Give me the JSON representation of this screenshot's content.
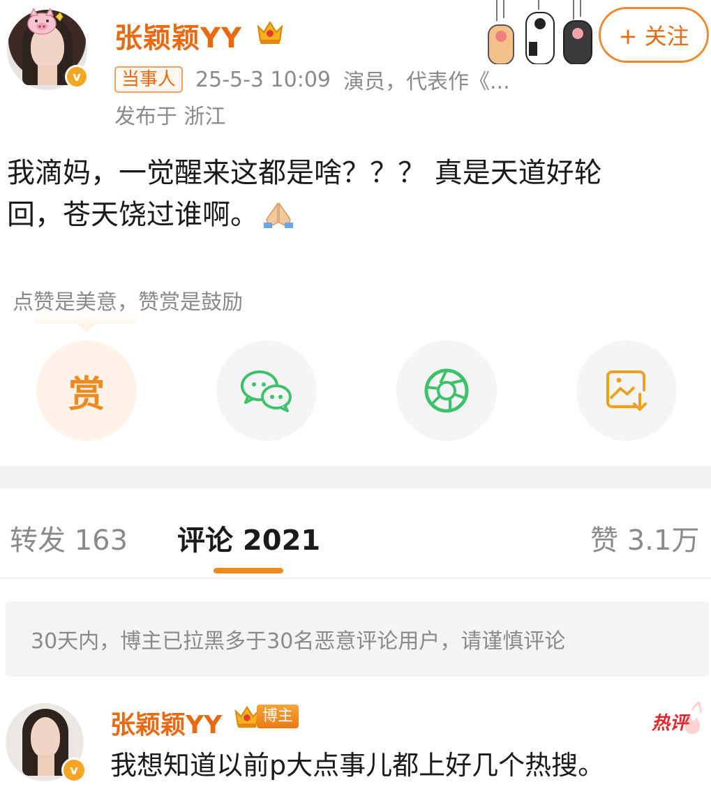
{
  "post": {
    "username": "张颖颖YY",
    "tag": "当事人",
    "time": "25-5-3 10:09",
    "bio": "演员，代表作《...",
    "location": "发布于 浙江",
    "content_line1": "我滴妈，一觉醒来这都是啥？？？ 真是天道好轮",
    "content_line2": "回，苍天饶过谁啊。",
    "follow_label": "+ 关注",
    "verified_badge": "v"
  },
  "reward": {
    "tip": "点赞是美意，赞赏是鼓励",
    "reward_char": "赏"
  },
  "actions": [
    {
      "name": "reward",
      "icon": "reward-icon"
    },
    {
      "name": "wechat",
      "icon": "wechat-icon"
    },
    {
      "name": "moments",
      "icon": "moments-icon"
    },
    {
      "name": "save-image",
      "icon": "save-image-icon"
    }
  ],
  "tabs": {
    "repost": "转发 163",
    "comments": "评论 2021",
    "likes": "赞 3.1万"
  },
  "notice": "30天内，博主已拉黑多于30名恶意评论用户，请谨慎评论",
  "comment": {
    "username": "张颖颖YY",
    "badge": "博主",
    "hot_label": "热评",
    "text": "我想知道以前p大点事儿都上好几个热搜。",
    "verified_badge": "v"
  },
  "colors": {
    "accent": "#e96a10",
    "wechat": "#3cc26a",
    "underline": "#f08a1e"
  }
}
